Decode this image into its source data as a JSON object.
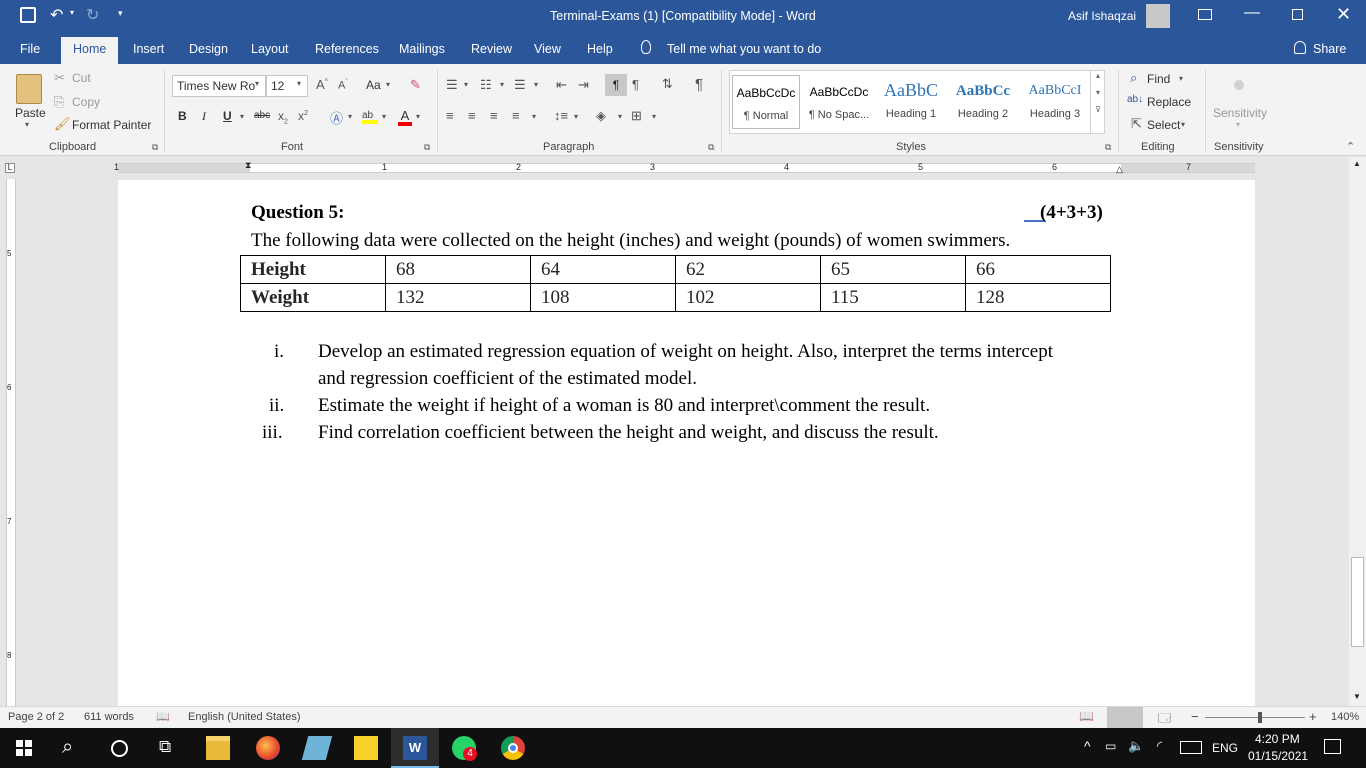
{
  "titlebar": {
    "title": "Terminal-Exams (1) [Compatibility Mode]  -  Word",
    "user": "Asif Ishaqzai"
  },
  "tabs": [
    "File",
    "Home",
    "Insert",
    "Design",
    "Layout",
    "References",
    "Mailings",
    "Review",
    "View",
    "Help"
  ],
  "tell_me": "Tell me what you want to do",
  "share": "Share",
  "clipboard": {
    "paste": "Paste",
    "cut": "Cut",
    "copy": "Copy",
    "format_painter": "Format Painter",
    "group": "Clipboard"
  },
  "font": {
    "name": "Times New Ro",
    "size": "12",
    "group": "Font",
    "bold": "B",
    "italic": "I",
    "underline": "U",
    "strike": "abc",
    "aa": "Aa"
  },
  "paragraph": {
    "group": "Paragraph"
  },
  "styles": {
    "group": "Styles",
    "items": [
      {
        "preview": "AaBbCcDc",
        "name": "¶ Normal"
      },
      {
        "preview": "AaBbCcDc",
        "name": "¶ No Spac..."
      },
      {
        "preview": "AaBbC",
        "name": "Heading 1"
      },
      {
        "preview": "AaBbCc",
        "name": "Heading 2"
      },
      {
        "preview": "AaBbCcI",
        "name": "Heading 3"
      }
    ]
  },
  "editing": {
    "find": "Find",
    "replace": "Replace",
    "select": "Select",
    "group": "Editing"
  },
  "sensitivity": {
    "label": "Sensitivity",
    "group": "Sensitivity"
  },
  "ruler_numbers": [
    "1",
    "1",
    "2",
    "3",
    "4",
    "5",
    "6",
    "7"
  ],
  "vruler_numbers": [
    "5",
    "6",
    "7",
    "8"
  ],
  "document": {
    "question_title": "Question 5:",
    "marks": "(4+3+3)",
    "intro": "The following data were collected on the height (inches) and weight (pounds) of women swimmers.",
    "table": [
      [
        "Height",
        "68",
        "64",
        "62",
        "65",
        "66"
      ],
      [
        "Weight",
        "132",
        "108",
        "102",
        "115",
        "128"
      ]
    ],
    "items": [
      {
        "num": "i.",
        "lines": [
          "Develop an estimated regression equation of weight on height. Also, interpret the terms intercept",
          "and regression coefficient of the estimated model."
        ]
      },
      {
        "num": "ii.",
        "lines": [
          "Estimate the weight if height of a woman is 80 and interpret\\comment the result."
        ]
      },
      {
        "num": "iii.",
        "lines": [
          "Find correlation coefficient between the height and weight, and discuss the result."
        ]
      }
    ]
  },
  "status": {
    "page": "Page 2 of 2",
    "words": "611 words",
    "language": "English (United States)",
    "zoom": "140%"
  },
  "taskbar": {
    "time": "4:20 PM",
    "date": "01/15/2021",
    "lang": "ENG",
    "whatsapp_badge": "4"
  },
  "colors": {
    "word_blue": "#2b579a",
    "ribbon_bg": "#f3f3f3",
    "heading_blue": "#2e74b5",
    "taskbar": "#101010"
  }
}
